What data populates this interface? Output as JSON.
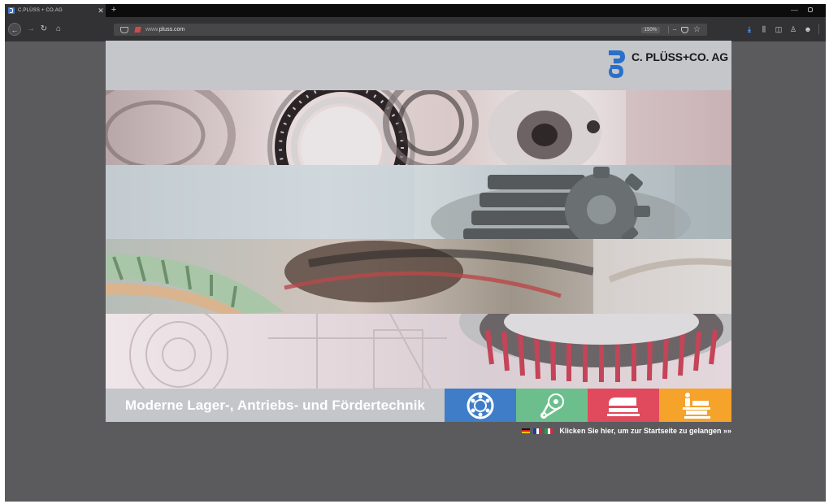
{
  "browser": {
    "tab_title": "C.PLÜSS + CO.AG",
    "tab_close": "✕",
    "new_tab": "+",
    "url_prefix": "www.",
    "url_domain": "pluss.com",
    "zoom": "150%",
    "url_more": "···",
    "icons": [
      "back-icon",
      "forward-icon",
      "reload-icon",
      "home-icon",
      "shield-icon",
      "pocket-icon",
      "star-icon",
      "download-icon",
      "library-icon",
      "sidebar-icon",
      "account-icon",
      "menu-icon"
    ]
  },
  "site": {
    "logo_text": "C. PLÜSS+CO. AG",
    "tagline": "Moderne Lager-, Antriebs- und Fördertechnik",
    "categories": [
      {
        "name": "bearing",
        "color": "#3f7dc8"
      },
      {
        "name": "drive-belt",
        "color": "#6cbf8c"
      },
      {
        "name": "conveyor",
        "color": "#e14a5c"
      },
      {
        "name": "lifting-table",
        "color": "#f5a32a"
      }
    ],
    "languages": [
      "de",
      "fr",
      "it"
    ],
    "enter_link": "Klicken Sie hier, um zur Startseite zu gelangen »»"
  },
  "colors": {
    "page_background": "#5b5b5e",
    "site_grey": "#c4c6c9",
    "logo_blue": "#2a6fc9"
  }
}
